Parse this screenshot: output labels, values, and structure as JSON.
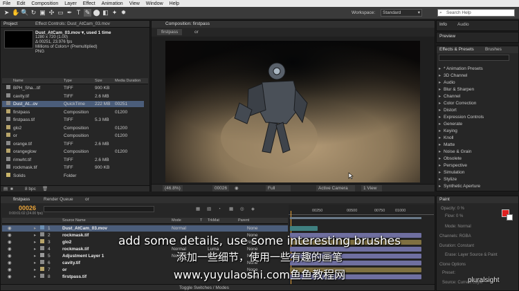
{
  "menu": [
    "File",
    "Edit",
    "Composition",
    "Layer",
    "Effect",
    "Animation",
    "View",
    "Window",
    "Help"
  ],
  "toolbar": {
    "workspace_label": "Workspace:",
    "workspace_value": "Standard",
    "search_placeholder": "Search Help"
  },
  "project": {
    "tab": "Project",
    "tab2": "Effect Controls: Dust_AtCam_03.mov",
    "filename": "Dust_AtCam_03.mov ▾, used 1 time",
    "meta1": "1280 x 720 (1.00)",
    "meta2": "Δ 00251, 23.976 fps",
    "meta3": "Millions of Colors+ (Premultiplied)",
    "meta4": "PNG",
    "headers": [
      "Name",
      "Type",
      "Size",
      "Media Duration"
    ],
    "items": [
      {
        "name": "BPH_Sha...tif",
        "type": "TIFF",
        "size": "900 KB",
        "dur": "",
        "color": "#8a8a8a"
      },
      {
        "name": "cavity.tif",
        "type": "TIFF",
        "size": "2.6 MB",
        "dur": "",
        "color": "#8a8a8a"
      },
      {
        "name": "Dust_At...ov",
        "type": "QuickTime",
        "size": "222 MB",
        "dur": "00251",
        "color": "#8a8a8a"
      },
      {
        "name": "firstpass",
        "type": "Composition",
        "size": "",
        "dur": "01200",
        "color": "#b7a46a"
      },
      {
        "name": "firstpass.tif",
        "type": "TIFF",
        "size": "5.3 MB",
        "dur": "",
        "color": "#8a8a8a"
      },
      {
        "name": "glo2",
        "type": "Composition",
        "size": "",
        "dur": "01200",
        "color": "#b7a46a"
      },
      {
        "name": "or",
        "type": "Composition",
        "size": "",
        "dur": "01200",
        "color": "#b7a46a"
      },
      {
        "name": "orange.tif",
        "type": "TIFF",
        "size": "2.6 MB",
        "dur": "",
        "color": "#8a8a8a"
      },
      {
        "name": "orangeglow",
        "type": "Composition",
        "size": "",
        "dur": "01200",
        "color": "#b7a46a"
      },
      {
        "name": "rimwht.tif",
        "type": "TIFF",
        "size": "2.6 MB",
        "dur": "",
        "color": "#8a8a8a"
      },
      {
        "name": "rockmask.tif",
        "type": "TIFF",
        "size": "900 KB",
        "dur": "",
        "color": "#8a8a8a"
      },
      {
        "name": "Solids",
        "type": "Folder",
        "size": "",
        "dur": "",
        "color": "#c9b46a"
      }
    ],
    "bpc": "8 bpc"
  },
  "comp": {
    "tab": "Composition: firstpass",
    "crumb1": "firstpass",
    "crumb2": "or",
    "zoom": "(46.8%)",
    "timecode": "00026",
    "resolution": "Full",
    "camera": "Active Camera",
    "view": "1 View"
  },
  "right": {
    "tab_info": "Info",
    "tab_audio": "Audio",
    "tab_preview": "Preview",
    "tab_effects": "Effects & Presets",
    "tab_brushes": "Brushes",
    "effects": [
      "* Animation Presets",
      "3D Channel",
      "Audio",
      "Blur & Sharpen",
      "Channel",
      "Color Correction",
      "Distort",
      "Expression Controls",
      "Generate",
      "Keying",
      "Knoll",
      "Matte",
      "Noise & Grain",
      "Obsolete",
      "Perspective",
      "Simulation",
      "Stylize",
      "Synthetic Aperture"
    ],
    "paint": {
      "tab": "Paint",
      "opacity": "Opacity: 0 %",
      "flow": "Flow: 0 %",
      "mode": "Mode: Normal",
      "channels": "Channels: RGBA",
      "duration": "Duration: Constant",
      "erase": "Erase: Layer Source & Paint",
      "clone": "Clone Options",
      "preset": "Preset:",
      "source": "Source: Current Layer",
      "fg": "#e02020"
    }
  },
  "timeline": {
    "tab1": "firstpass",
    "tab2": "Render Queue",
    "tab3": "or",
    "time": "00026",
    "time_sub": "0:00:01:02 (24.00 fps)",
    "headers": [
      "Source Name",
      "Mode",
      "T",
      "TrkMat",
      "Parent"
    ],
    "ruler": [
      "00250",
      "00500",
      "00750",
      "01000"
    ],
    "layers": [
      {
        "num": "1",
        "name": "Dust_AtCam_03.mov",
        "mode": "Normal",
        "trk": "",
        "parent": "None",
        "color": "#6b8fb3",
        "bar": "#3f7f7f"
      },
      {
        "num": "2",
        "name": "rockmask.tif",
        "mode": "",
        "trk": "",
        "parent": "None",
        "color": "#8b8b8b",
        "bar": "#6f6fa0"
      },
      {
        "num": "3",
        "name": "glo2",
        "mode": "",
        "trk": "",
        "parent": "None",
        "color": "#b7a46a",
        "bar": "#7f7040"
      },
      {
        "num": "4",
        "name": "rockmask.tif",
        "mode": "Normal",
        "trk": "Luma",
        "parent": "None",
        "color": "#8b8b8b",
        "bar": "#6f6fa0"
      },
      {
        "num": "5",
        "name": "Adjustment Layer 1",
        "mode": "Normal",
        "trk": "None",
        "parent": "None",
        "color": "#9a9a9a",
        "bar": "#6f6fa0"
      },
      {
        "num": "6",
        "name": "cavity.tif",
        "mode": "",
        "trk": "",
        "parent": "None",
        "color": "#8b8b8b",
        "bar": "#6f6fa0"
      },
      {
        "num": "7",
        "name": "or",
        "mode": "",
        "trk": "",
        "parent": "None",
        "color": "#b7a46a",
        "bar": "#7f7040"
      },
      {
        "num": "8",
        "name": "firstpass.tif",
        "mode": "",
        "trk": "",
        "parent": "None",
        "color": "#8b8b8b",
        "bar": "#6f6fa0"
      }
    ],
    "toggle": "Toggle Switches / Modes"
  },
  "subtitles": {
    "en": "add some details, use some interesting brushes",
    "zh": "添加一些细节，使用一些有趣的画笔",
    "url": "www.yuyulaoshi.com鱼鱼教程网"
  },
  "watermark": "pluralsight"
}
